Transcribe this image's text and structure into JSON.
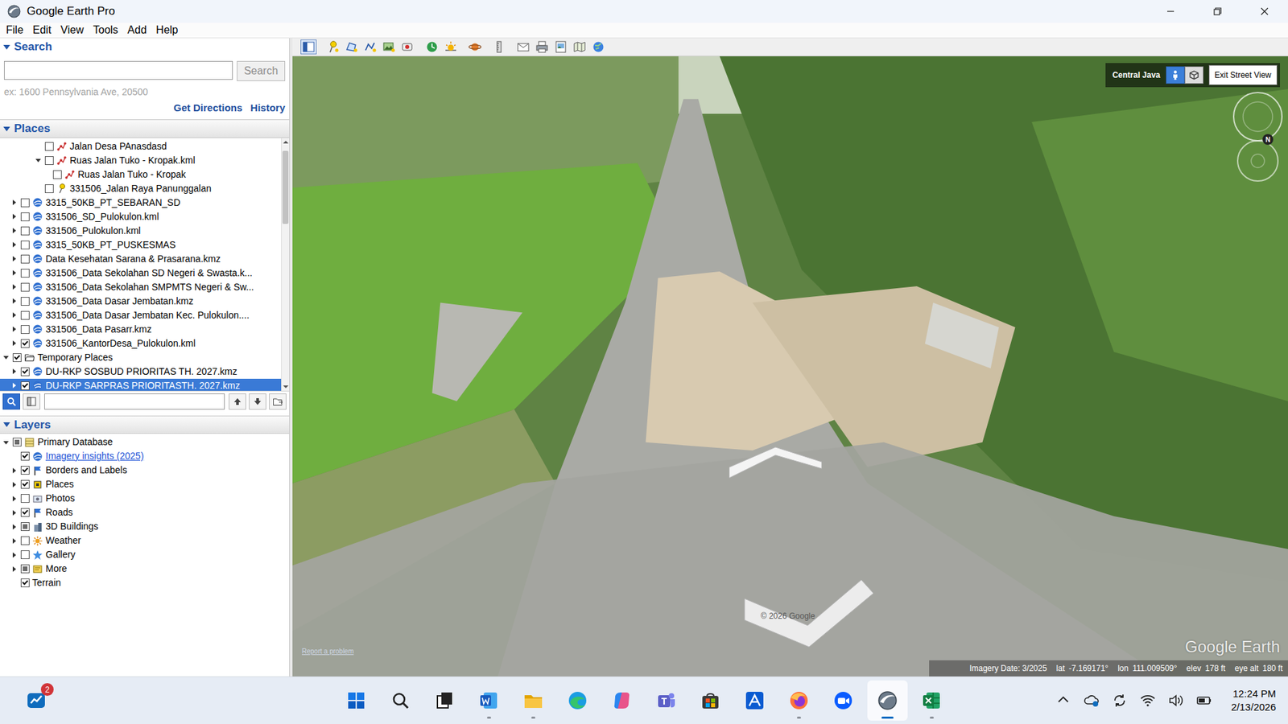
{
  "window": {
    "title": "Google Earth Pro"
  },
  "menu": [
    "File",
    "Edit",
    "View",
    "Tools",
    "Add",
    "Help"
  ],
  "search": {
    "header": "Search",
    "expanded": true,
    "value": "",
    "button": "Search",
    "hint": "ex: 1600 Pennsylvania Ave, 20500",
    "links": [
      "Get Directions",
      "History"
    ]
  },
  "places": {
    "header": "Places",
    "expanded": true,
    "scroll": {
      "start": 0.02,
      "size": 0.31
    },
    "items": [
      {
        "label": "Jalan Desa PAnasdasd",
        "depth": 4,
        "toggle": "none",
        "check": "off",
        "icon": "path",
        "selected": false
      },
      {
        "label": "Ruas Jalan Tuko - Kropak.kml",
        "depth": 4,
        "toggle": "open",
        "check": "off",
        "icon": "path",
        "selected": false
      },
      {
        "label": "Ruas Jalan Tuko - Kropak",
        "depth": 5,
        "toggle": "none",
        "check": "off",
        "icon": "path",
        "selected": false
      },
      {
        "label": "331506_Jalan Raya Panunggalan",
        "depth": 4,
        "toggle": "none",
        "check": "off",
        "icon": "placemark",
        "selected": false
      },
      {
        "label": "3315_50KB_PT_SEBARAN_SD",
        "depth": 1,
        "toggle": "closed",
        "check": "off",
        "icon": "network",
        "selected": false
      },
      {
        "label": "331506_SD_Pulokulon.kml",
        "depth": 1,
        "toggle": "closed",
        "check": "off",
        "icon": "network",
        "selected": false
      },
      {
        "label": "331506_Pulokulon.kml",
        "depth": 1,
        "toggle": "closed",
        "check": "off",
        "icon": "network",
        "selected": false
      },
      {
        "label": "3315_50KB_PT_PUSKESMAS",
        "depth": 1,
        "toggle": "closed",
        "check": "off",
        "icon": "network",
        "selected": false
      },
      {
        "label": "Data Kesehatan Sarana & Prasarana.kmz",
        "depth": 1,
        "toggle": "closed",
        "check": "off",
        "icon": "network",
        "selected": false
      },
      {
        "label": "331506_Data Sekolahan SD Negeri & Swasta.k...",
        "depth": 1,
        "toggle": "closed",
        "check": "off",
        "icon": "network",
        "selected": false
      },
      {
        "label": "331506_Data Sekolahan SMPMTS Negeri & Sw...",
        "depth": 1,
        "toggle": "closed",
        "check": "off",
        "icon": "network",
        "selected": false
      },
      {
        "label": "331506_Data Dasar Jembatan.kmz",
        "depth": 1,
        "toggle": "closed",
        "check": "off",
        "icon": "network",
        "selected": false
      },
      {
        "label": "331506_Data Dasar Jembatan Kec. Pulokulon....",
        "depth": 1,
        "toggle": "closed",
        "check": "off",
        "icon": "network",
        "selected": false
      },
      {
        "label": "331506_Data Pasarr.kmz",
        "depth": 1,
        "toggle": "closed",
        "check": "off",
        "icon": "network",
        "selected": false
      },
      {
        "label": "331506_KantorDesa_Pulokulon.kml",
        "depth": 1,
        "toggle": "closed",
        "check": "on",
        "icon": "network",
        "selected": false
      },
      {
        "label": "Temporary Places",
        "depth": 0,
        "toggle": "open",
        "check": "on",
        "icon": "folder",
        "selected": false
      },
      {
        "label": "DU-RKP SOSBUD PRIORITAS TH. 2027.kmz",
        "depth": 1,
        "toggle": "closed",
        "check": "on",
        "icon": "network",
        "selected": false
      },
      {
        "label": "DU-RKP SARPRAS PRIORITASTH. 2027.kmz",
        "depth": 1,
        "toggle": "closed",
        "check": "on",
        "icon": "network",
        "selected": true
      }
    ],
    "tools": [
      {
        "kind": "search",
        "selected": true
      },
      {
        "kind": "panel",
        "selected": false
      }
    ],
    "filter": {
      "value": ""
    },
    "nav": [
      {
        "kind": "up"
      },
      {
        "kind": "down"
      },
      {
        "kind": "folder"
      }
    ]
  },
  "layers": {
    "header": "Layers",
    "expanded": true,
    "items": [
      {
        "label": "Primary Database",
        "depth": 0,
        "toggle": "open",
        "check": "partial",
        "icon": "database",
        "kind": "plain"
      },
      {
        "label": "Imagery insights (2025)",
        "depth": 1,
        "toggle": "none",
        "check": "on",
        "icon": "network",
        "kind": "link"
      },
      {
        "label": "Borders and Labels",
        "depth": 1,
        "toggle": "closed",
        "check": "on",
        "icon": "flag",
        "kind": "plain"
      },
      {
        "label": "Places",
        "depth": 1,
        "toggle": "closed",
        "check": "on",
        "icon": "places",
        "kind": "plain"
      },
      {
        "label": "Photos",
        "depth": 1,
        "toggle": "closed",
        "check": "off",
        "icon": "photos",
        "kind": "plain"
      },
      {
        "label": "Roads",
        "depth": 1,
        "toggle": "closed",
        "check": "on",
        "icon": "flag",
        "kind": "plain"
      },
      {
        "label": "3D Buildings",
        "depth": 1,
        "toggle": "closed",
        "check": "partial",
        "icon": "building",
        "kind": "plain"
      },
      {
        "label": "Weather",
        "depth": 1,
        "toggle": "closed",
        "check": "off",
        "icon": "weather",
        "kind": "plain"
      },
      {
        "label": "Gallery",
        "depth": 1,
        "toggle": "closed",
        "check": "off",
        "icon": "gallery",
        "kind": "plain"
      },
      {
        "label": "More",
        "depth": 1,
        "toggle": "closed",
        "check": "partial",
        "icon": "more",
        "kind": "plain"
      },
      {
        "label": "Terrain",
        "depth": 1,
        "toggle": "none",
        "check": "on",
        "icon": "none",
        "kind": "plain"
      }
    ]
  },
  "toolbar": [
    [
      {
        "kind": "sidebar",
        "selected": true
      }
    ],
    [
      {
        "kind": "placemark",
        "selected": false
      },
      {
        "kind": "polygon",
        "selected": false
      },
      {
        "kind": "path",
        "selected": false
      },
      {
        "kind": "overlay",
        "selected": false
      },
      {
        "kind": "tour",
        "selected": false
      }
    ],
    [
      {
        "kind": "history",
        "selected": false
      },
      {
        "kind": "sun",
        "selected": false
      }
    ],
    [
      {
        "kind": "planets",
        "selected": false
      }
    ],
    [
      {
        "kind": "ruler",
        "selected": false
      }
    ],
    [
      {
        "kind": "email",
        "selected": false
      },
      {
        "kind": "print",
        "selected": false
      },
      {
        "kind": "image",
        "selected": false
      },
      {
        "kind": "map",
        "selected": false
      },
      {
        "kind": "earth",
        "selected": false
      }
    ]
  ],
  "viewer": {
    "region": "Central Java",
    "modes": [
      {
        "kind": "person",
        "selected": true
      },
      {
        "kind": "cube",
        "selected": false
      }
    ],
    "exit": "Exit Street View",
    "compass": "N",
    "copyright": "© 2026 Google",
    "report": "Report a problem",
    "watermark": "Google Earth",
    "status": {
      "imagery_date": "Imagery Date: 3/2025",
      "fields": [
        {
          "label": "lat",
          "value": "-7.169171°"
        },
        {
          "label": "lon",
          "value": "111.009509°"
        },
        {
          "label": "elev",
          "value": "178 ft"
        },
        {
          "label": "eye alt",
          "value": "180 ft"
        }
      ]
    }
  },
  "taskbar": {
    "widget": {
      "badge": "2"
    },
    "apps": [
      {
        "kind": "start",
        "running": false,
        "active": false
      },
      {
        "kind": "search",
        "running": false,
        "active": false
      },
      {
        "kind": "taskview",
        "running": false,
        "active": false
      },
      {
        "kind": "word",
        "running": true,
        "active": false
      },
      {
        "kind": "explorer",
        "running": true,
        "active": false
      },
      {
        "kind": "edge",
        "running": false,
        "active": false
      },
      {
        "kind": "copilot",
        "running": false,
        "active": false
      },
      {
        "kind": "teams",
        "running": false,
        "active": false
      },
      {
        "kind": "store",
        "running": false,
        "active": false
      },
      {
        "kind": "devapp",
        "running": false,
        "active": false
      },
      {
        "kind": "firefox",
        "running": true,
        "active": false
      },
      {
        "kind": "zoom",
        "running": false,
        "active": false
      },
      {
        "kind": "earth",
        "running": true,
        "active": true
      },
      {
        "kind": "excel",
        "running": true,
        "active": false
      }
    ],
    "tray": [
      {
        "kind": "chevron"
      },
      {
        "kind": "cloud"
      },
      {
        "kind": "sync"
      },
      {
        "kind": "wifi"
      },
      {
        "kind": "volume"
      },
      {
        "kind": "battery"
      }
    ],
    "time": "12:24 PM",
    "date": "2/13/2026"
  }
}
